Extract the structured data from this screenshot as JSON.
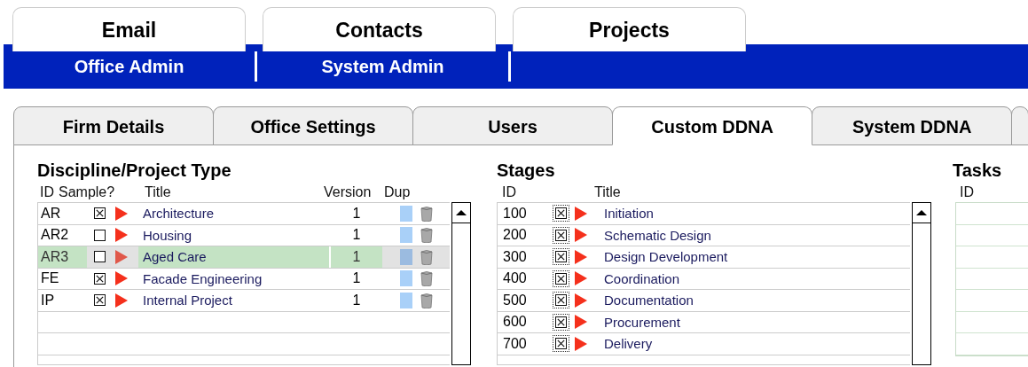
{
  "main_tabs": [
    {
      "label": "Email",
      "selected": false
    },
    {
      "label": "Contacts",
      "selected": false
    },
    {
      "label": "Projects",
      "selected": false
    }
  ],
  "admin_nav": [
    {
      "label": "Office Admin"
    },
    {
      "label": "System Admin"
    }
  ],
  "tabs": [
    {
      "label": "Firm Details",
      "selected": false
    },
    {
      "label": "Office Settings",
      "selected": false
    },
    {
      "label": "Users",
      "selected": false
    },
    {
      "label": "Custom DDNA",
      "selected": true
    },
    {
      "label": "System DDNA",
      "selected": false
    }
  ],
  "disciplines": {
    "title": "Discipline/Project Type",
    "columns": [
      "ID",
      "Sample?",
      "Title",
      "Version",
      "Dup"
    ],
    "rows": [
      {
        "id": "AR",
        "sample": true,
        "title": "Architecture",
        "version": "1",
        "selected": false
      },
      {
        "id": "AR2",
        "sample": false,
        "title": "Housing",
        "version": "1",
        "selected": false
      },
      {
        "id": "AR3",
        "sample": false,
        "title": "Aged Care",
        "version": "1",
        "selected": true
      },
      {
        "id": "FE",
        "sample": true,
        "title": "Facade Engineering",
        "version": "1",
        "selected": false
      },
      {
        "id": "IP",
        "sample": true,
        "title": "Internal Project",
        "version": "1",
        "selected": false
      }
    ]
  },
  "stages": {
    "title": "Stages",
    "columns": [
      "ID",
      "Title"
    ],
    "rows": [
      {
        "id": "100",
        "checked": true,
        "title": "Initiation"
      },
      {
        "id": "200",
        "checked": true,
        "title": "Schematic Design"
      },
      {
        "id": "300",
        "checked": true,
        "title": "Design Development"
      },
      {
        "id": "400",
        "checked": true,
        "title": "Coordination"
      },
      {
        "id": "500",
        "checked": true,
        "title": "Documentation"
      },
      {
        "id": "600",
        "checked": true,
        "title": "Procurement"
      },
      {
        "id": "700",
        "checked": true,
        "title": "Delivery"
      }
    ]
  },
  "tasks": {
    "title": "Tasks",
    "columns": [
      "ID"
    ]
  }
}
